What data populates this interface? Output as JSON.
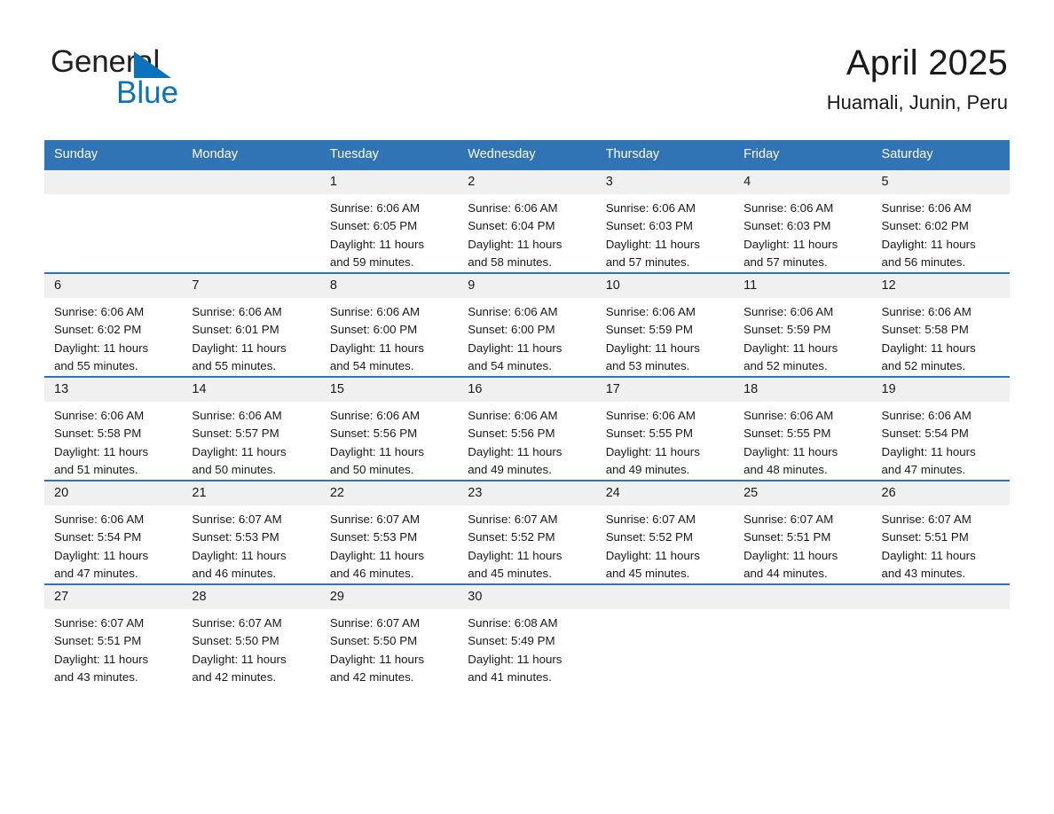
{
  "brand": {
    "word_one": "General",
    "word_two": "Blue",
    "triangle_color": "#0d72b9",
    "text_color": "#231f20"
  },
  "header": {
    "title": "April 2025",
    "subtitle": "Huamali, Junin, Peru"
  },
  "theme": {
    "header_blue": "#3174b6",
    "daynum_band": "#f0f0f0",
    "text": "#1a1a1a"
  },
  "calendar": {
    "weekday_headers": [
      "Sunday",
      "Monday",
      "Tuesday",
      "Wednesday",
      "Thursday",
      "Friday",
      "Saturday"
    ],
    "weeks": [
      [
        {
          "day": "",
          "sunrise": "",
          "sunset": "",
          "daylight_1": "",
          "daylight_2": ""
        },
        {
          "day": "",
          "sunrise": "",
          "sunset": "",
          "daylight_1": "",
          "daylight_2": ""
        },
        {
          "day": "1",
          "sunrise": "Sunrise: 6:06 AM",
          "sunset": "Sunset: 6:05 PM",
          "daylight_1": "Daylight: 11 hours",
          "daylight_2": "and 59 minutes."
        },
        {
          "day": "2",
          "sunrise": "Sunrise: 6:06 AM",
          "sunset": "Sunset: 6:04 PM",
          "daylight_1": "Daylight: 11 hours",
          "daylight_2": "and 58 minutes."
        },
        {
          "day": "3",
          "sunrise": "Sunrise: 6:06 AM",
          "sunset": "Sunset: 6:03 PM",
          "daylight_1": "Daylight: 11 hours",
          "daylight_2": "and 57 minutes."
        },
        {
          "day": "4",
          "sunrise": "Sunrise: 6:06 AM",
          "sunset": "Sunset: 6:03 PM",
          "daylight_1": "Daylight: 11 hours",
          "daylight_2": "and 57 minutes."
        },
        {
          "day": "5",
          "sunrise": "Sunrise: 6:06 AM",
          "sunset": "Sunset: 6:02 PM",
          "daylight_1": "Daylight: 11 hours",
          "daylight_2": "and 56 minutes."
        }
      ],
      [
        {
          "day": "6",
          "sunrise": "Sunrise: 6:06 AM",
          "sunset": "Sunset: 6:02 PM",
          "daylight_1": "Daylight: 11 hours",
          "daylight_2": "and 55 minutes."
        },
        {
          "day": "7",
          "sunrise": "Sunrise: 6:06 AM",
          "sunset": "Sunset: 6:01 PM",
          "daylight_1": "Daylight: 11 hours",
          "daylight_2": "and 55 minutes."
        },
        {
          "day": "8",
          "sunrise": "Sunrise: 6:06 AM",
          "sunset": "Sunset: 6:00 PM",
          "daylight_1": "Daylight: 11 hours",
          "daylight_2": "and 54 minutes."
        },
        {
          "day": "9",
          "sunrise": "Sunrise: 6:06 AM",
          "sunset": "Sunset: 6:00 PM",
          "daylight_1": "Daylight: 11 hours",
          "daylight_2": "and 54 minutes."
        },
        {
          "day": "10",
          "sunrise": "Sunrise: 6:06 AM",
          "sunset": "Sunset: 5:59 PM",
          "daylight_1": "Daylight: 11 hours",
          "daylight_2": "and 53 minutes."
        },
        {
          "day": "11",
          "sunrise": "Sunrise: 6:06 AM",
          "sunset": "Sunset: 5:59 PM",
          "daylight_1": "Daylight: 11 hours",
          "daylight_2": "and 52 minutes."
        },
        {
          "day": "12",
          "sunrise": "Sunrise: 6:06 AM",
          "sunset": "Sunset: 5:58 PM",
          "daylight_1": "Daylight: 11 hours",
          "daylight_2": "and 52 minutes."
        }
      ],
      [
        {
          "day": "13",
          "sunrise": "Sunrise: 6:06 AM",
          "sunset": "Sunset: 5:58 PM",
          "daylight_1": "Daylight: 11 hours",
          "daylight_2": "and 51 minutes."
        },
        {
          "day": "14",
          "sunrise": "Sunrise: 6:06 AM",
          "sunset": "Sunset: 5:57 PM",
          "daylight_1": "Daylight: 11 hours",
          "daylight_2": "and 50 minutes."
        },
        {
          "day": "15",
          "sunrise": "Sunrise: 6:06 AM",
          "sunset": "Sunset: 5:56 PM",
          "daylight_1": "Daylight: 11 hours",
          "daylight_2": "and 50 minutes."
        },
        {
          "day": "16",
          "sunrise": "Sunrise: 6:06 AM",
          "sunset": "Sunset: 5:56 PM",
          "daylight_1": "Daylight: 11 hours",
          "daylight_2": "and 49 minutes."
        },
        {
          "day": "17",
          "sunrise": "Sunrise: 6:06 AM",
          "sunset": "Sunset: 5:55 PM",
          "daylight_1": "Daylight: 11 hours",
          "daylight_2": "and 49 minutes."
        },
        {
          "day": "18",
          "sunrise": "Sunrise: 6:06 AM",
          "sunset": "Sunset: 5:55 PM",
          "daylight_1": "Daylight: 11 hours",
          "daylight_2": "and 48 minutes."
        },
        {
          "day": "19",
          "sunrise": "Sunrise: 6:06 AM",
          "sunset": "Sunset: 5:54 PM",
          "daylight_1": "Daylight: 11 hours",
          "daylight_2": "and 47 minutes."
        }
      ],
      [
        {
          "day": "20",
          "sunrise": "Sunrise: 6:06 AM",
          "sunset": "Sunset: 5:54 PM",
          "daylight_1": "Daylight: 11 hours",
          "daylight_2": "and 47 minutes."
        },
        {
          "day": "21",
          "sunrise": "Sunrise: 6:07 AM",
          "sunset": "Sunset: 5:53 PM",
          "daylight_1": "Daylight: 11 hours",
          "daylight_2": "and 46 minutes."
        },
        {
          "day": "22",
          "sunrise": "Sunrise: 6:07 AM",
          "sunset": "Sunset: 5:53 PM",
          "daylight_1": "Daylight: 11 hours",
          "daylight_2": "and 46 minutes."
        },
        {
          "day": "23",
          "sunrise": "Sunrise: 6:07 AM",
          "sunset": "Sunset: 5:52 PM",
          "daylight_1": "Daylight: 11 hours",
          "daylight_2": "and 45 minutes."
        },
        {
          "day": "24",
          "sunrise": "Sunrise: 6:07 AM",
          "sunset": "Sunset: 5:52 PM",
          "daylight_1": "Daylight: 11 hours",
          "daylight_2": "and 45 minutes."
        },
        {
          "day": "25",
          "sunrise": "Sunrise: 6:07 AM",
          "sunset": "Sunset: 5:51 PM",
          "daylight_1": "Daylight: 11 hours",
          "daylight_2": "and 44 minutes."
        },
        {
          "day": "26",
          "sunrise": "Sunrise: 6:07 AM",
          "sunset": "Sunset: 5:51 PM",
          "daylight_1": "Daylight: 11 hours",
          "daylight_2": "and 43 minutes."
        }
      ],
      [
        {
          "day": "27",
          "sunrise": "Sunrise: 6:07 AM",
          "sunset": "Sunset: 5:51 PM",
          "daylight_1": "Daylight: 11 hours",
          "daylight_2": "and 43 minutes."
        },
        {
          "day": "28",
          "sunrise": "Sunrise: 6:07 AM",
          "sunset": "Sunset: 5:50 PM",
          "daylight_1": "Daylight: 11 hours",
          "daylight_2": "and 42 minutes."
        },
        {
          "day": "29",
          "sunrise": "Sunrise: 6:07 AM",
          "sunset": "Sunset: 5:50 PM",
          "daylight_1": "Daylight: 11 hours",
          "daylight_2": "and 42 minutes."
        },
        {
          "day": "30",
          "sunrise": "Sunrise: 6:08 AM",
          "sunset": "Sunset: 5:49 PM",
          "daylight_1": "Daylight: 11 hours",
          "daylight_2": "and 41 minutes."
        },
        {
          "day": "",
          "sunrise": "",
          "sunset": "",
          "daylight_1": "",
          "daylight_2": ""
        },
        {
          "day": "",
          "sunrise": "",
          "sunset": "",
          "daylight_1": "",
          "daylight_2": ""
        },
        {
          "day": "",
          "sunrise": "",
          "sunset": "",
          "daylight_1": "",
          "daylight_2": ""
        }
      ]
    ]
  }
}
